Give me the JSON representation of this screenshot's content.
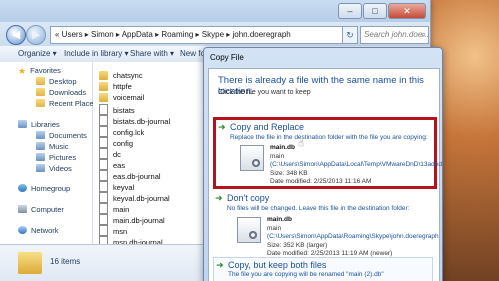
{
  "explorer": {
    "caption_min": "–",
    "caption_max": "□",
    "caption_close": "✕",
    "nav_back": "◀",
    "nav_forward": "▶",
    "address_path": "« Users ▸ Simon ▸ AppData ▸ Roaming ▸ Skype ▸ john.doeregraph",
    "refresh_glyph": "↻",
    "search_placeholder": "Search john.doe...",
    "search_glyph": "⌕",
    "toolbar": {
      "organize": "Organize ▾",
      "include": "Include in library ▾",
      "share": "Share with ▾",
      "new_folder": "New fold"
    },
    "nav": {
      "favorites": "Favorites",
      "desktop": "Desktop",
      "downloads": "Downloads",
      "recent": "Recent Places",
      "libraries": "Libraries",
      "documents": "Documents",
      "music": "Music",
      "pictures": "Pictures",
      "videos": "Videos",
      "homegroup": "Homegroup",
      "computer": "Computer",
      "network": "Network"
    },
    "files": [
      {
        "name": "chatsync",
        "kind": "folder"
      },
      {
        "name": "httpfe",
        "kind": "folder"
      },
      {
        "name": "voicemail",
        "kind": "folder"
      },
      {
        "name": "bistats",
        "kind": "doc"
      },
      {
        "name": "bistats.db-journal",
        "kind": "doc"
      },
      {
        "name": "config.lck",
        "kind": "doc"
      },
      {
        "name": "config",
        "kind": "doc"
      },
      {
        "name": "dc",
        "kind": "doc"
      },
      {
        "name": "eas",
        "kind": "doc"
      },
      {
        "name": "eas.db-journal",
        "kind": "doc"
      },
      {
        "name": "keyval",
        "kind": "doc"
      },
      {
        "name": "keyval.db-journal",
        "kind": "doc"
      },
      {
        "name": "main",
        "kind": "doc"
      },
      {
        "name": "main.db-journal",
        "kind": "doc"
      },
      {
        "name": "msn",
        "kind": "doc"
      },
      {
        "name": "msn.db-journal",
        "kind": "doc"
      }
    ],
    "status": "16 items"
  },
  "dialog": {
    "title": "Copy File",
    "heading": "There is already a file with the same name in this location.",
    "subheading": "Click the file you want to keep",
    "arrow_glyph": "➜",
    "copy_replace": {
      "title": "Copy and Replace",
      "desc": "Replace the file in the destination folder with the file you are copying:",
      "file": "main.db",
      "name": "main",
      "path": "(C:\\Users\\Simon\\AppData\\Local\\Temp\\VMwareDnD\\13ad6d",
      "size": "Size: 348 KB",
      "date": "Date modified: 2/25/2013 11:16 AM"
    },
    "dont_copy": {
      "title": "Don't copy",
      "desc": "No files will be changed. Leave this file in the destination folder:",
      "file": "main.db",
      "name": "main",
      "path": "(C:\\Users\\Simon\\AppData\\Roaming\\Skype\\john.doeregraph",
      "size": "Size: 352 KB (larger)",
      "date": "Date modified: 2/25/2013 11:19 AM (newer)"
    },
    "keep_both": {
      "title": "Copy, but keep both files",
      "desc": "The file you are copying will be renamed \"main (2).db\""
    }
  }
}
